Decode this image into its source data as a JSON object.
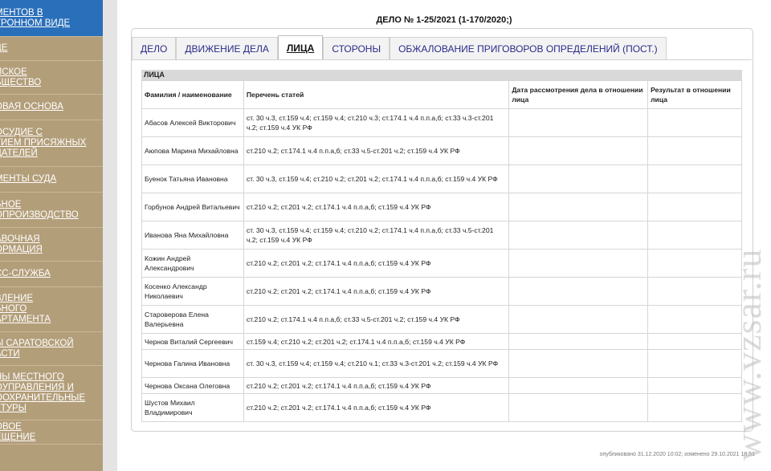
{
  "sidebar": {
    "items": [
      {
        "label": "МЕНТОВ В\nТРОННОМ ВИДЕ",
        "active": true,
        "height": 46
      },
      {
        "label": "ДЕ",
        "height": 30
      },
      {
        "label": "ЙСКОЕ\nБЩЕСТВО",
        "height": 42
      },
      {
        "label": "ОВАЯ ОСНОВА",
        "height": 32
      },
      {
        "label": "ОСУДИЕ С\nТИЕМ ПРИСЯЖНЫХ\nДАТЕЛЕЙ",
        "height": 58
      },
      {
        "label": "МЕНТЫ СУДА",
        "height": 32
      },
      {
        "label": "БНОЕ\nОПРОИЗВОДСТВО",
        "height": 44
      },
      {
        "label": "АВОЧНАЯ\nОРМАЦИЯ",
        "height": 42
      },
      {
        "label": "СС-СЛУЖБА",
        "height": 32
      },
      {
        "label": "ВЛЕНИЕ\nБНОГО\nАРТАМЕНТА",
        "height": 56
      },
      {
        "label": "Ы САРАТОВСКОЙ\nАСТИ",
        "height": 42
      },
      {
        "label": "НЫ МЕСТНОГО\nОУПРАВЛЕНИЯ И\nООХРАНИТЕЛЬНЫЕ\nКТУРЫ",
        "height": 68
      },
      {
        "label": "ОВОЕ\nЕЩЕНИЕ",
        "height": 30
      }
    ]
  },
  "case": {
    "title": "ДЕЛО № 1-25/2021 (1-170/2020;)"
  },
  "tabs": [
    {
      "label": "ДЕЛО",
      "active": false
    },
    {
      "label": "ДВИЖЕНИЕ ДЕЛА",
      "active": false
    },
    {
      "label": "ЛИЦА",
      "active": true
    },
    {
      "label": "СТОРОНЫ",
      "active": false
    },
    {
      "label": "ОБЖАЛОВАНИЕ ПРИГОВОРОВ ОПРЕДЕЛЕНИЙ (ПОСТ.)",
      "active": false
    }
  ],
  "section": {
    "title": "ЛИЦА"
  },
  "table": {
    "headers": {
      "name": "Фамилия / наименование",
      "articles": "Перечень статей",
      "date": "Дата рассмотрения дела в отношении лица",
      "result": "Результат в отношении лица"
    },
    "rows": [
      {
        "name": "Абасов Алексей Викторович",
        "articles": "ст. 30 ч.3, ст.159 ч.4; ст.159 ч.4; ст.210 ч.3; ст.174.1 ч.4 п.п.а,б; ст.33 ч.3-ст.201 ч.2; ст.159 ч.4 УК РФ",
        "date": "",
        "result": ""
      },
      {
        "name": "Аюпова Марина Михайловна",
        "articles": "ст.210 ч.2; ст.174.1 ч.4 п.п.а,б; ст.33 ч.5-ст.201 ч.2; ст.159 ч.4 УК РФ",
        "date": "",
        "result": ""
      },
      {
        "name": "Буенок Татьяна Ивановна",
        "articles": "ст. 30 ч.3, ст.159 ч.4; ст.210 ч.2; ст.201 ч.2; ст.174.1 ч.4 п.п.а,б; ст.159 ч.4 УК РФ",
        "date": "",
        "result": ""
      },
      {
        "name": "Горбунов Андрей Витальевич",
        "articles": "ст.210 ч.2; ст.201 ч.2; ст.174.1 ч.4 п.п.а,б; ст.159 ч.4 УК РФ",
        "date": "",
        "result": ""
      },
      {
        "name": "Иванова Яна Михайловна",
        "articles": "ст. 30 ч.3, ст.159 ч.4; ст.159 ч.4; ст.210 ч.2; ст.174.1 ч.4 п.п.а,б; ст.33 ч.5-ст.201 ч.2; ст.159 ч.4 УК РФ",
        "date": "",
        "result": ""
      },
      {
        "name": "Кожин Андрей Александрович",
        "articles": "ст.210 ч.2; ст.201 ч.2; ст.174.1 ч.4 п.п.а,б; ст.159 ч.4 УК РФ",
        "date": "",
        "result": ""
      },
      {
        "name": "Косенко Александр Николаевич",
        "articles": "ст.210 ч.2; ст.201 ч.2; ст.174.1 ч.4 п.п.а,б; ст.159 ч.4 УК РФ",
        "date": "",
        "result": ""
      },
      {
        "name": "Староверова Елена Валерьевна",
        "articles": "ст.210 ч.2; ст.174.1 ч.4 п.п.а,б; ст.33 ч.5-ст.201 ч.2; ст.159 ч.4 УК РФ",
        "date": "",
        "result": ""
      },
      {
        "name": "Чернов Виталий Сергеевич",
        "articles": "ст.159 ч.4; ст.210 ч.2; ст.201 ч.2; ст.174.1 ч.4 п.п.а,б; ст.159 ч.4 УК РФ",
        "date": "",
        "result": ""
      },
      {
        "name": "Чернова Галина Ивановна",
        "articles": "ст. 30 ч.3, ст.159 ч.4; ст.159 ч.4; ст.210 ч.1; ст.33 ч.3-ст.201 ч.2; ст.159 ч.4 УК РФ",
        "date": "",
        "result": ""
      },
      {
        "name": "Чернова Оксана Олеговна",
        "articles": "ст.210 ч.2; ст.201 ч.2; ст.174.1 ч.4 п.п.а,б; ст.159 ч.4 УК РФ",
        "date": "",
        "result": ""
      },
      {
        "name": "Шустов Михаил Владимирович",
        "articles": "ст.210 ч.2; ст.201 ч.2; ст.174.1 ч.4 п.п.а,б; ст.159 ч.4 УК РФ",
        "date": "",
        "result": ""
      }
    ]
  },
  "footer": {
    "published": "опубликовано 31.12.2020 10:02; изменено 29.10.2021 18:51"
  },
  "watermark": {
    "text": "www.vzsar.ru"
  }
}
